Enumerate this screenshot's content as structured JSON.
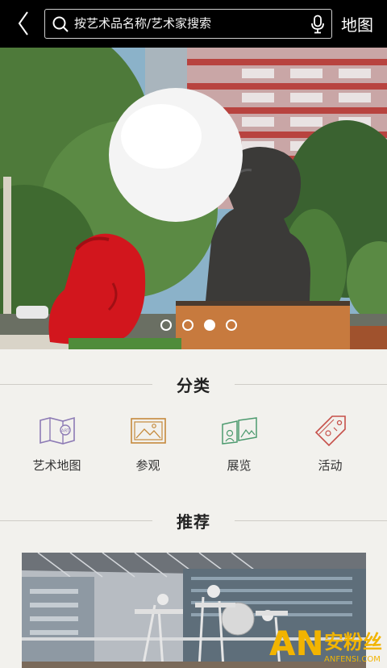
{
  "header": {
    "back_icon": "chevron-left-icon",
    "search_placeholder": "按艺术品名称/艺术家搜索",
    "search_icon": "search-icon",
    "mic_icon": "microphone-icon",
    "map_label": "地图"
  },
  "banner": {
    "dots": 4,
    "active_dot": 2
  },
  "categories_section": {
    "title": "分类",
    "items": [
      {
        "label": "艺术地图",
        "icon": "art-map-icon",
        "color": "#8d7bb5"
      },
      {
        "label": "参观",
        "icon": "picture-frame-icon",
        "color": "#c58a3c"
      },
      {
        "label": "展览",
        "icon": "exhibition-icon",
        "color": "#4c9a6e"
      },
      {
        "label": "活动",
        "icon": "ticket-tag-icon",
        "color": "#c6504a"
      }
    ]
  },
  "recommend_section": {
    "title": "推荐"
  },
  "watermark": {
    "big": "AN",
    "cn": "安粉丝",
    "url": "ANFENSI.COM"
  }
}
